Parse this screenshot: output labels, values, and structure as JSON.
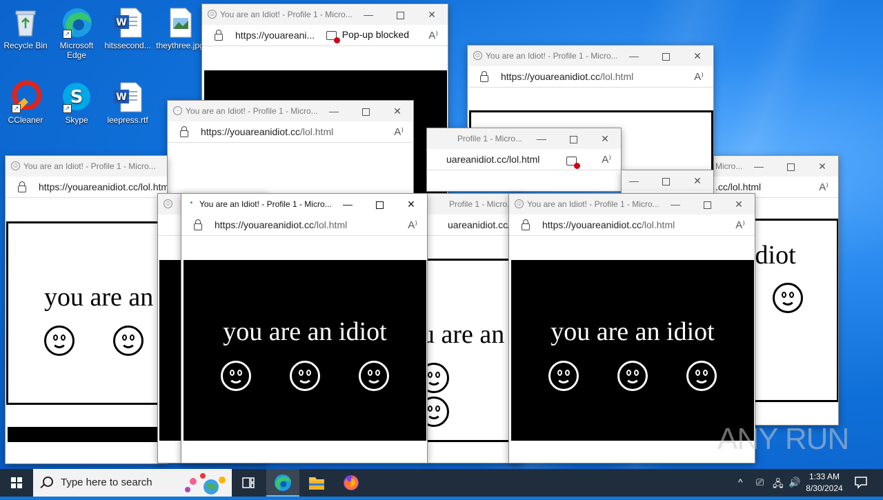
{
  "desktop": {
    "icons": [
      {
        "label": "Recycle Bin"
      },
      {
        "label": "Microsoft Edge"
      },
      {
        "label": "hitssecond..."
      },
      {
        "label": "theythree.jpg"
      },
      {
        "label": "CCleaner"
      },
      {
        "label": "Skype"
      },
      {
        "label": "leepress.rtf"
      }
    ]
  },
  "windows": {
    "title": "You are an Idiot! - Profile 1 - Micro...",
    "title_partial": "Profile 1 - Micro...",
    "title_partial2": "Micro...",
    "url_full": "https://youareanidiot.cc/lol.html",
    "url_host": "https://youareanidiot.cc",
    "url_path": "/lol.html",
    "url_trunc": "https://youareani...",
    "url_trunc2": "https://youareanidiot.cc/lol.htm",
    "url_left_cut": "uareanidiot.cc/lol.html",
    "url_left_cut2": "uareanidiot.cc/lo",
    "url_left_cut3": ".cc/lol.html",
    "popup_blocked": "Pop-up blocked",
    "content_text": "you are an idiot",
    "content_text_right": "idiot",
    "content_text_mid": "u are an",
    "content_text_left": "you are an"
  },
  "watermark": "ANY RUN",
  "taskbar": {
    "search_placeholder": "Type here to search",
    "time": "1:33 AM",
    "date": "8/30/2024"
  }
}
